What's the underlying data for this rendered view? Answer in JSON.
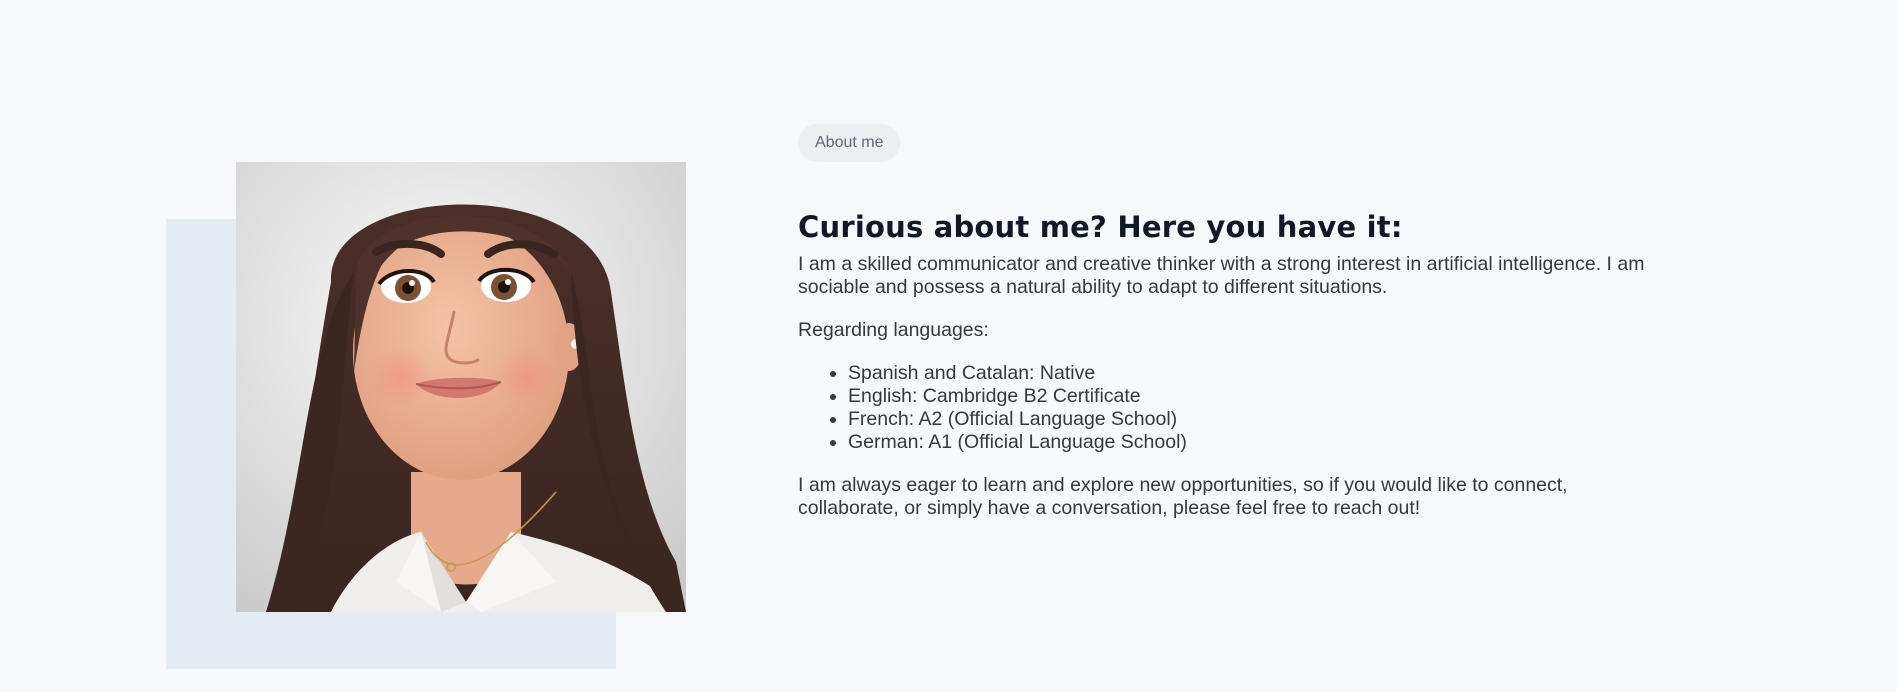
{
  "about": {
    "badge_label": "About me",
    "heading": "Curious about me? Here you have it:",
    "intro": "I am a skilled communicator and creative thinker with a strong interest in artificial intelligence. I am sociable and possess a natural ability to adapt to different situations.",
    "languages_intro": "Regarding languages:",
    "languages": [
      "Spanish and Catalan: Native",
      "English: Cambridge B2 Certificate",
      "French: A2 (Official Language School)",
      "German: A1 (Official Language School)"
    ],
    "outro": "I am always eager to learn and explore new opportunities, so if you would like to connect, collaborate, or simply have a conversation, please feel free to reach out!"
  },
  "colors": {
    "page_background": "#f7f8fb",
    "backdrop": "#e4ebf2",
    "badge_background": "#eceef2",
    "heading": "#111827",
    "body_text": "#36383d"
  }
}
